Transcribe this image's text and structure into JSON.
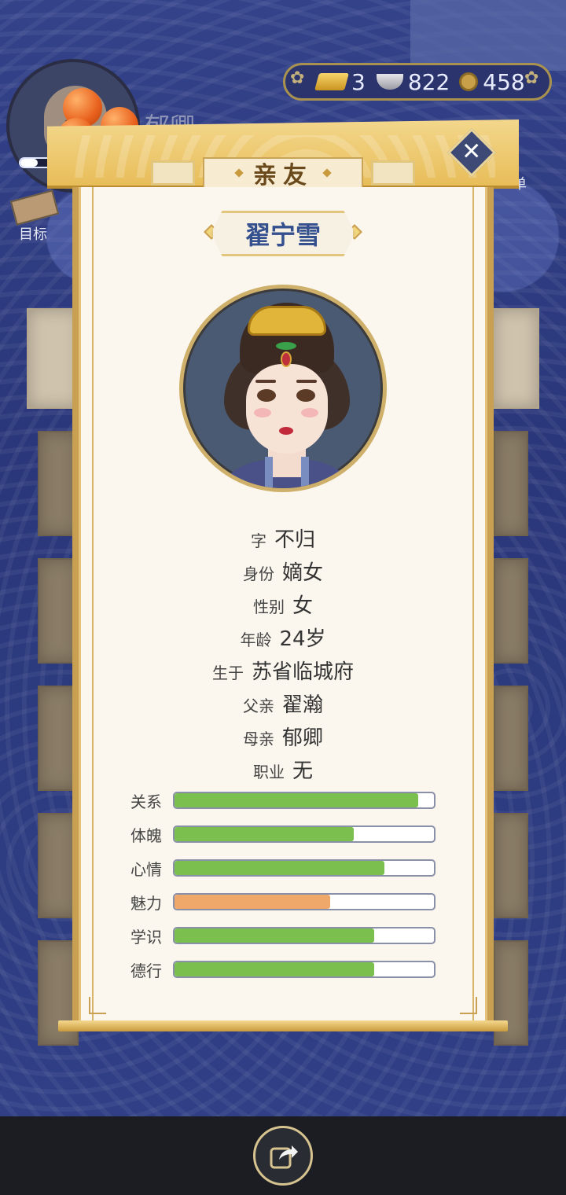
{
  "background": {
    "character_name": "郁卿",
    "goal_label": "目标",
    "menu_label": "菜单",
    "currency": {
      "gold": "3",
      "silver": "822",
      "copper": "458"
    }
  },
  "dialog": {
    "title": "亲友",
    "close_icon": "close-icon"
  },
  "profile": {
    "name": "翟宁雪",
    "fields": [
      {
        "key": "字",
        "value": "不归"
      },
      {
        "key": "身份",
        "value": "嫡女"
      },
      {
        "key": "性别",
        "value": "女"
      },
      {
        "key": "年龄",
        "value": "24岁"
      },
      {
        "key": "生于",
        "value": "苏省临城府"
      },
      {
        "key": "父亲",
        "value": "翟瀚"
      },
      {
        "key": "母亲",
        "value": "郁卿"
      },
      {
        "key": "职业",
        "value": "无"
      }
    ],
    "stats": [
      {
        "label": "关系",
        "fraction": 0.94,
        "color": "#7bc04f"
      },
      {
        "label": "体魄",
        "fraction": 0.69,
        "color": "#7bc04f"
      },
      {
        "label": "心情",
        "fraction": 0.81,
        "color": "#7bc04f"
      },
      {
        "label": "魅力",
        "fraction": 0.6,
        "color": "#f0a86a"
      },
      {
        "label": "学识",
        "fraction": 0.77,
        "color": "#7bc04f"
      },
      {
        "label": "德行",
        "fraction": 0.77,
        "color": "#7bc04f"
      }
    ]
  },
  "footer": {
    "share_icon": "share-icon"
  }
}
